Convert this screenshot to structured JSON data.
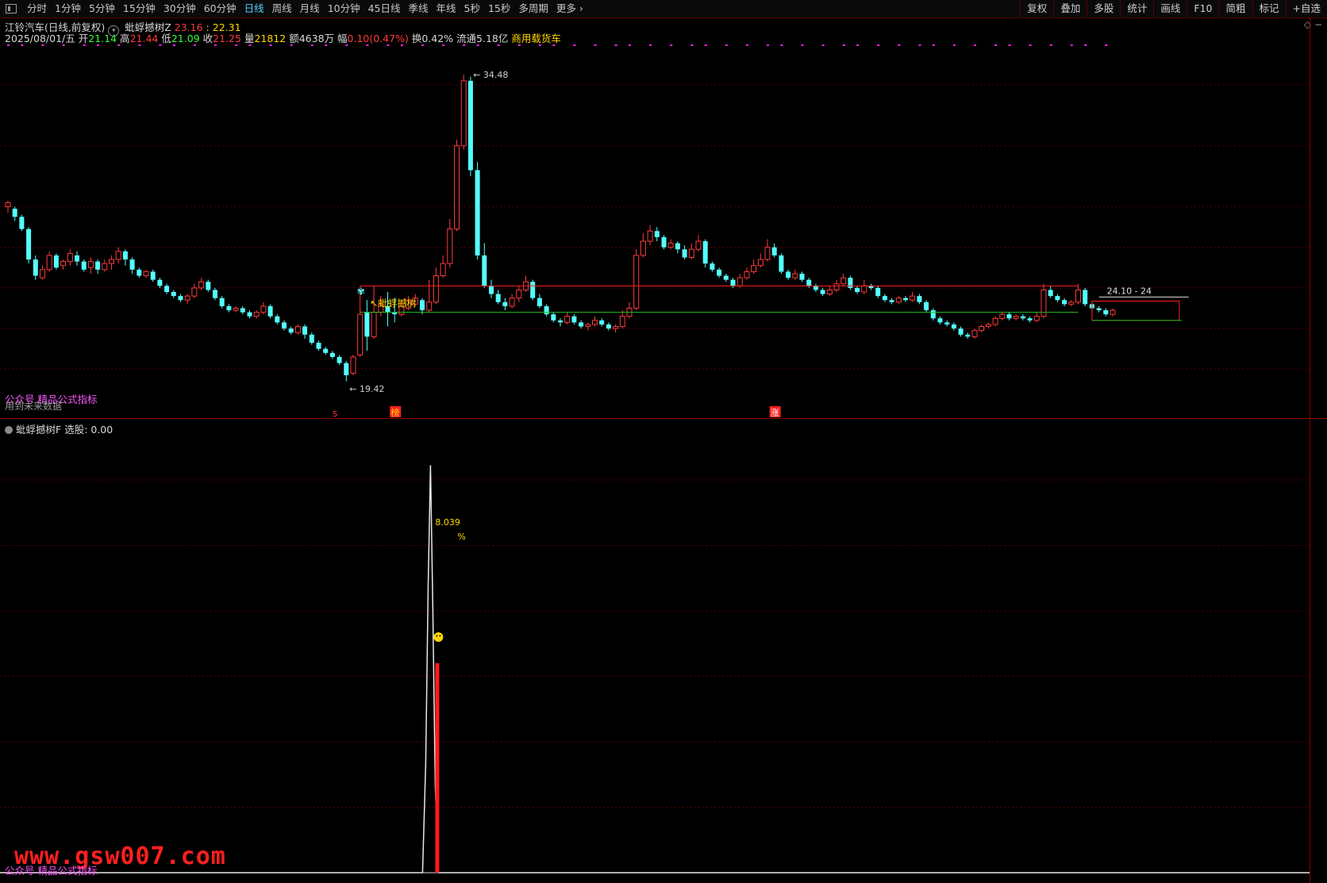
{
  "toolbar": {
    "periods": [
      "分时",
      "1分钟",
      "5分钟",
      "15分钟",
      "30分钟",
      "60分钟",
      "日线",
      "周线",
      "月线",
      "10分钟",
      "45日线",
      "季线",
      "年线",
      "5秒",
      "15秒",
      "多周期",
      "更多"
    ],
    "active_period": "日线",
    "tools": [
      "复权",
      "叠加",
      "多股",
      "统计",
      "画线",
      "F10",
      "简粗",
      "标记",
      "+自选"
    ]
  },
  "stock": {
    "name": "江铃汽车(日线,前复权)",
    "indicator": "蚍蜉撼树Z",
    "ind_val1": "23.16",
    "ind_sep": ":",
    "ind_val2": "22.31"
  },
  "ohlc": {
    "date": "2025/08/01/五",
    "open_label": "开",
    "open": "21.14",
    "high_label": "高",
    "high": "21.44",
    "low_label": "低",
    "low": "21.09",
    "close_label": "收",
    "close": "21.25",
    "vol_label": "量",
    "vol": "21812",
    "amt_label": "额",
    "amt": "4638万",
    "chg_label": "幅",
    "chg": "0.10(0.47%)",
    "turn_label": "换",
    "turn": "0.42%",
    "float_label": "流通",
    "float": "5.18亿",
    "sector": "商用载货车"
  },
  "annotations": {
    "high_price": "34.48",
    "low_price": "19.42",
    "signal_label": "蚍蜉撼树",
    "range_label": "24.10 - 24",
    "marker_s": "S",
    "marker_bang": "榜",
    "marker_zhang": "涨"
  },
  "watermarks": {
    "main": "公众号 精品公式指标",
    "main_hint": "用到未来数据",
    "sub": "公众号 精品公式指标",
    "site": "www.gsw007.com"
  },
  "sub_panel": {
    "title": "蚍蜉撼树F",
    "field": "选股: 0.00",
    "peak_value": "8.039",
    "peak_unit": "%"
  },
  "colors": {
    "up": "#ff3a3a",
    "down": "#54ffff",
    "grid": "#5a0000",
    "magenta": "#ff1fff",
    "yellow": "#ffd800"
  },
  "chart_data": {
    "type": "candlestick",
    "price_range": [
      18.8,
      35.6
    ],
    "resistance_line": 24.1,
    "support_line": 22.8,
    "candles": [
      [
        28.0,
        28.2,
        27.7,
        28.3
      ],
      [
        27.9,
        27.5,
        27.3,
        28.0
      ],
      [
        27.5,
        26.9,
        26.8,
        27.6
      ],
      [
        26.9,
        25.4,
        25.2,
        27.0
      ],
      [
        25.4,
        24.6,
        24.4,
        25.6
      ],
      [
        24.5,
        24.9,
        24.4,
        25.1
      ],
      [
        24.9,
        25.6,
        24.8,
        25.8
      ],
      [
        25.6,
        25.0,
        24.9,
        25.7
      ],
      [
        25.1,
        25.3,
        24.9,
        25.4
      ],
      [
        25.3,
        25.7,
        25.1,
        25.9
      ],
      [
        25.6,
        25.3,
        25.1,
        25.8
      ],
      [
        25.3,
        24.9,
        24.8,
        25.4
      ],
      [
        25.0,
        25.3,
        24.7,
        25.5
      ],
      [
        25.3,
        24.9,
        24.7,
        25.4
      ],
      [
        24.9,
        25.2,
        24.8,
        25.4
      ],
      [
        25.2,
        25.4,
        24.9,
        25.6
      ],
      [
        25.4,
        25.8,
        25.2,
        26.0
      ],
      [
        25.8,
        25.4,
        25.1,
        25.9
      ],
      [
        25.4,
        24.9,
        24.7,
        25.5
      ],
      [
        24.9,
        24.6,
        24.5,
        25.0
      ],
      [
        24.6,
        24.8,
        24.5,
        24.9
      ],
      [
        24.8,
        24.4,
        24.3,
        24.9
      ],
      [
        24.4,
        24.1,
        24.0,
        24.5
      ],
      [
        24.1,
        23.8,
        23.7,
        24.2
      ],
      [
        23.8,
        23.6,
        23.5,
        23.9
      ],
      [
        23.6,
        23.4,
        23.3,
        23.7
      ],
      [
        23.4,
        23.6,
        23.2,
        23.7
      ],
      [
        23.6,
        24.0,
        23.5,
        24.2
      ],
      [
        24.0,
        24.3,
        23.9,
        24.5
      ],
      [
        24.3,
        23.9,
        23.8,
        24.4
      ],
      [
        23.9,
        23.5,
        23.4,
        24.0
      ],
      [
        23.5,
        23.1,
        23.0,
        23.6
      ],
      [
        23.1,
        22.9,
        22.8,
        23.2
      ],
      [
        22.9,
        23.0,
        22.8,
        23.1
      ],
      [
        23.0,
        22.8,
        22.7,
        23.1
      ],
      [
        22.8,
        22.6,
        22.5,
        22.9
      ],
      [
        22.6,
        22.8,
        22.5,
        22.9
      ],
      [
        22.8,
        23.1,
        22.7,
        23.3
      ],
      [
        23.1,
        22.6,
        22.5,
        23.2
      ],
      [
        22.6,
        22.3,
        22.2,
        22.7
      ],
      [
        22.3,
        22.0,
        21.9,
        22.4
      ],
      [
        22.0,
        21.8,
        21.7,
        22.1
      ],
      [
        21.8,
        22.1,
        21.7,
        22.2
      ],
      [
        22.1,
        21.7,
        21.5,
        22.2
      ],
      [
        21.7,
        21.3,
        21.2,
        21.8
      ],
      [
        21.3,
        21.0,
        20.9,
        21.4
      ],
      [
        21.0,
        20.8,
        20.7,
        21.1
      ],
      [
        20.8,
        20.6,
        20.5,
        20.9
      ],
      [
        20.6,
        20.3,
        20.2,
        20.7
      ],
      [
        20.3,
        19.7,
        19.4,
        20.4
      ],
      [
        19.8,
        20.6,
        19.7,
        20.7
      ],
      [
        20.7,
        22.7,
        20.6,
        23.0
      ],
      [
        22.8,
        21.6,
        20.9,
        23.4
      ],
      [
        21.6,
        22.8,
        21.5,
        24.1
      ],
      [
        22.8,
        23.2,
        22.6,
        23.6
      ],
      [
        23.1,
        22.8,
        22.1,
        23.8
      ],
      [
        22.8,
        22.7,
        22.3,
        23.5
      ],
      [
        22.7,
        23.1,
        22.6,
        23.4
      ],
      [
        23.0,
        23.4,
        22.9,
        23.6
      ],
      [
        23.2,
        23.5,
        23.1,
        23.7
      ],
      [
        23.4,
        22.9,
        22.7,
        23.5
      ],
      [
        22.9,
        23.3,
        22.8,
        24.4
      ],
      [
        23.3,
        24.6,
        23.2,
        25.0
      ],
      [
        24.6,
        25.2,
        24.5,
        25.6
      ],
      [
        25.2,
        26.9,
        25.0,
        27.4
      ],
      [
        26.9,
        31.0,
        26.8,
        31.3
      ],
      [
        31.0,
        34.2,
        30.8,
        34.5
      ],
      [
        34.2,
        29.8,
        29.5,
        34.4
      ],
      [
        29.8,
        25.6,
        25.4,
        30.2
      ],
      [
        25.6,
        24.1,
        24.0,
        26.2
      ],
      [
        24.1,
        23.7,
        23.5,
        24.4
      ],
      [
        23.7,
        23.3,
        23.2,
        23.9
      ],
      [
        23.3,
        23.1,
        22.9,
        23.5
      ],
      [
        23.1,
        23.5,
        23.0,
        23.7
      ],
      [
        23.5,
        23.9,
        23.3,
        24.1
      ],
      [
        23.9,
        24.3,
        23.8,
        24.6
      ],
      [
        24.3,
        23.5,
        23.4,
        24.4
      ],
      [
        23.5,
        23.1,
        23.0,
        23.7
      ],
      [
        23.1,
        22.7,
        22.6,
        23.2
      ],
      [
        22.7,
        22.4,
        22.3,
        22.8
      ],
      [
        22.4,
        22.3,
        22.1,
        22.5
      ],
      [
        22.3,
        22.6,
        22.2,
        22.8
      ],
      [
        22.6,
        22.3,
        22.2,
        22.7
      ],
      [
        22.3,
        22.1,
        22.0,
        22.4
      ],
      [
        22.1,
        22.2,
        21.9,
        22.3
      ],
      [
        22.2,
        22.4,
        22.1,
        22.6
      ],
      [
        22.4,
        22.2,
        22.1,
        22.5
      ],
      [
        22.2,
        22.0,
        21.9,
        22.3
      ],
      [
        22.0,
        22.1,
        21.8,
        22.2
      ],
      [
        22.1,
        22.6,
        22.0,
        22.9
      ],
      [
        22.6,
        23.0,
        22.5,
        23.3
      ],
      [
        23.0,
        25.6,
        22.9,
        25.9
      ],
      [
        25.6,
        26.3,
        25.5,
        26.7
      ],
      [
        26.3,
        26.8,
        26.1,
        27.1
      ],
      [
        26.8,
        26.5,
        26.3,
        27.0
      ],
      [
        26.5,
        26.0,
        25.9,
        26.6
      ],
      [
        26.0,
        26.2,
        25.9,
        26.4
      ],
      [
        26.2,
        25.9,
        25.7,
        26.3
      ],
      [
        25.9,
        25.5,
        25.4,
        26.1
      ],
      [
        25.5,
        25.9,
        25.4,
        26.2
      ],
      [
        25.9,
        26.3,
        25.8,
        26.6
      ],
      [
        26.3,
        25.2,
        25.0,
        26.4
      ],
      [
        25.2,
        24.9,
        24.8,
        25.3
      ],
      [
        24.9,
        24.6,
        24.5,
        25.0
      ],
      [
        24.6,
        24.4,
        24.3,
        24.7
      ],
      [
        24.4,
        24.1,
        24.0,
        24.5
      ],
      [
        24.1,
        24.5,
        24.0,
        24.7
      ],
      [
        24.5,
        24.8,
        24.4,
        25.0
      ],
      [
        24.8,
        25.1,
        24.7,
        25.4
      ],
      [
        25.1,
        25.4,
        25.0,
        25.7
      ],
      [
        25.4,
        26.0,
        25.3,
        26.4
      ],
      [
        26.0,
        25.6,
        25.5,
        26.2
      ],
      [
        25.6,
        24.8,
        24.7,
        25.7
      ],
      [
        24.8,
        24.5,
        24.4,
        24.9
      ],
      [
        24.5,
        24.7,
        24.4,
        24.9
      ],
      [
        24.7,
        24.4,
        24.3,
        24.8
      ],
      [
        24.4,
        24.1,
        24.0,
        24.5
      ],
      [
        24.1,
        23.9,
        23.8,
        24.2
      ],
      [
        23.9,
        23.7,
        23.6,
        24.0
      ],
      [
        23.7,
        23.9,
        23.6,
        24.1
      ],
      [
        23.9,
        24.2,
        23.8,
        24.4
      ],
      [
        24.2,
        24.5,
        24.1,
        24.7
      ],
      [
        24.5,
        24.0,
        23.9,
        24.6
      ],
      [
        24.0,
        23.8,
        23.7,
        24.1
      ],
      [
        23.8,
        24.1,
        23.7,
        24.4
      ],
      [
        24.1,
        24.0,
        23.9,
        24.2
      ],
      [
        24.0,
        23.6,
        23.5,
        24.1
      ],
      [
        23.6,
        23.4,
        23.3,
        23.7
      ],
      [
        23.4,
        23.3,
        23.2,
        23.5
      ],
      [
        23.3,
        23.5,
        23.2,
        23.6
      ],
      [
        23.5,
        23.4,
        23.3,
        23.6
      ],
      [
        23.4,
        23.6,
        23.3,
        23.8
      ],
      [
        23.6,
        23.3,
        23.2,
        23.7
      ],
      [
        23.3,
        22.9,
        22.8,
        23.4
      ],
      [
        22.9,
        22.5,
        22.4,
        23.0
      ],
      [
        22.5,
        22.3,
        22.2,
        22.6
      ],
      [
        22.3,
        22.2,
        22.1,
        22.4
      ],
      [
        22.2,
        22.0,
        21.9,
        22.3
      ],
      [
        22.0,
        21.7,
        21.6,
        22.1
      ],
      [
        21.7,
        21.6,
        21.5,
        21.8
      ],
      [
        21.6,
        21.9,
        21.5,
        22.0
      ],
      [
        21.9,
        22.1,
        21.8,
        22.2
      ],
      [
        22.1,
        22.2,
        22.0,
        22.3
      ],
      [
        22.2,
        22.5,
        22.1,
        22.6
      ],
      [
        22.5,
        22.7,
        22.4,
        22.8
      ],
      [
        22.7,
        22.5,
        22.4,
        22.8
      ],
      [
        22.5,
        22.6,
        22.4,
        22.7
      ],
      [
        22.6,
        22.5,
        22.4,
        22.7
      ],
      [
        22.5,
        22.4,
        22.3,
        22.6
      ],
      [
        22.4,
        22.6,
        22.3,
        22.8
      ],
      [
        22.6,
        23.9,
        22.5,
        24.2
      ],
      [
        23.9,
        23.6,
        23.5,
        24.1
      ],
      [
        23.6,
        23.4,
        23.3,
        23.7
      ],
      [
        23.4,
        23.2,
        23.1,
        23.5
      ],
      [
        23.2,
        23.3,
        23.1,
        23.4
      ],
      [
        23.3,
        23.9,
        23.2,
        24.2
      ],
      [
        23.9,
        23.2,
        23.1,
        24.0
      ],
      [
        23.2,
        23.0,
        22.9,
        23.3
      ],
      [
        23.0,
        22.9,
        22.8,
        23.1
      ],
      [
        22.9,
        22.7,
        22.6,
        23.0
      ],
      [
        22.7,
        22.9,
        22.6,
        23.0
      ]
    ],
    "sub_series": {
      "name": "蚍蜉撼树F",
      "spike_index": 52,
      "peak": 8.039,
      "bar_value": 4.8,
      "y_range": [
        0,
        10
      ]
    }
  }
}
